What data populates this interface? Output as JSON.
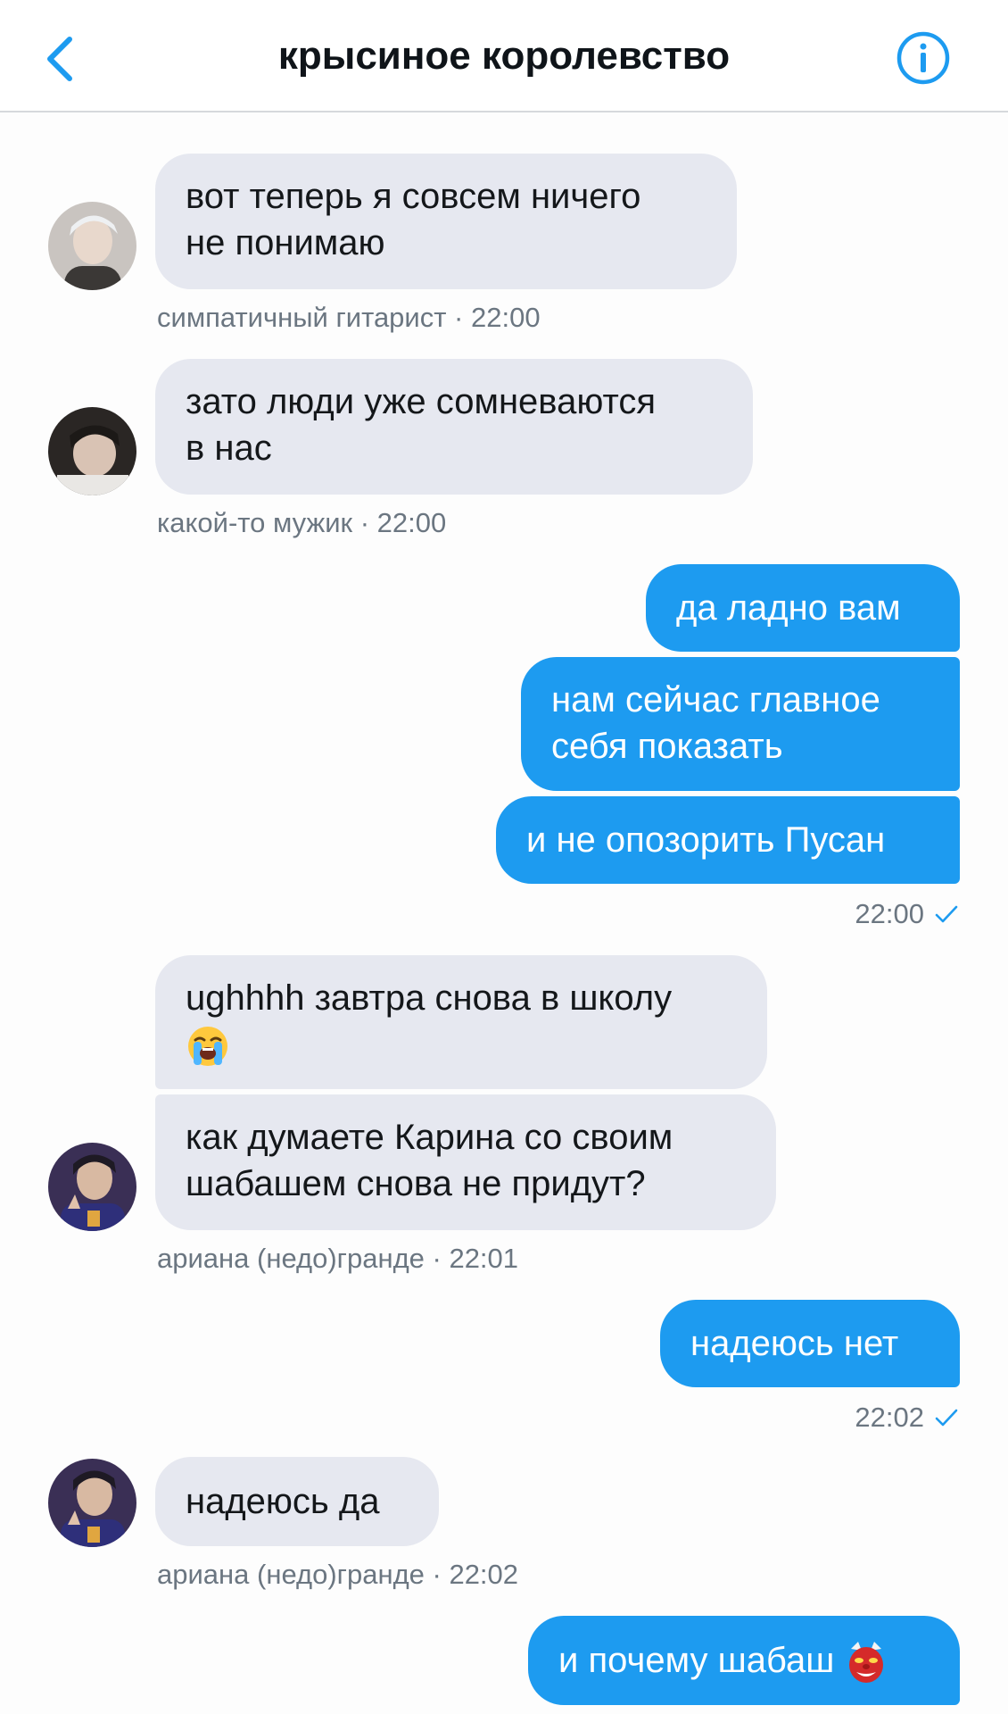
{
  "header": {
    "title": "крысиное королевство",
    "back_icon": "chevron-left-icon",
    "info_icon": "info-circle-icon",
    "accent": "#1d9bf0"
  },
  "messages": [
    {
      "direction": "in",
      "lines": [
        "вот теперь я совсем ничего",
        "не понимаю"
      ],
      "sender": "симпатичный гитарист · 22:00"
    },
    {
      "direction": "in",
      "lines": [
        "зато люди уже сомневаются",
        "в нас"
      ],
      "sender": "какой-то мужик · 22:00"
    },
    {
      "direction": "out",
      "lines": [
        "да ладно вам"
      ]
    },
    {
      "direction": "out",
      "lines": [
        "нам сейчас главное",
        "себя показать"
      ]
    },
    {
      "direction": "out",
      "lines": [
        "и не опозорить Пусан"
      ],
      "time": "22:00"
    },
    {
      "direction": "in",
      "lines": [
        "ughhhh завтра снова в школу"
      ],
      "emoji": "loudly-crying-face"
    },
    {
      "direction": "in",
      "lines": [
        "как думаете Карина со своим",
        "шабашем снова не придут?"
      ],
      "sender": "ариана (недо)гранде  · 22:01"
    },
    {
      "direction": "out",
      "lines": [
        "надеюсь нет"
      ],
      "time": "22:02"
    },
    {
      "direction": "in",
      "lines": [
        "надеюсь да"
      ],
      "sender": "ариана (недо)гранде  · 22:02"
    },
    {
      "direction": "out",
      "lines": [
        "и почему шабаш"
      ],
      "emoji": "goblin-mask"
    }
  ],
  "colors": {
    "incoming_bubble": "#e6e8f0",
    "outgoing_bubble": "#1d9bf0",
    "meta_text": "#6b7681"
  }
}
